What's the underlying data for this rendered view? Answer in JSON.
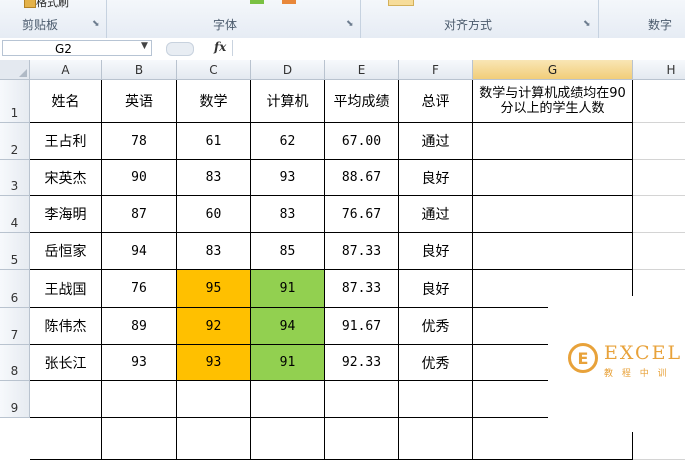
{
  "ribbon": {
    "groups": [
      "剪贴板",
      "字体",
      "对齐方式",
      "数字"
    ],
    "format_painter": "格式刷"
  },
  "formula_bar": {
    "name_box": "G2",
    "fx": "fx",
    "formula": ""
  },
  "columns": [
    "A",
    "B",
    "C",
    "D",
    "E",
    "F",
    "G",
    "H"
  ],
  "selected_column": "G",
  "rows": [
    "1",
    "2",
    "3",
    "4",
    "5",
    "6",
    "7",
    "8",
    "9"
  ],
  "table": {
    "headers": [
      "姓名",
      "英语",
      "数学",
      "计算机",
      "平均成绩",
      "总评",
      "数学与计算机成绩均在90分以上的学生人数"
    ],
    "data": [
      [
        "王占利",
        "78",
        "61",
        "62",
        "67.00",
        "通过"
      ],
      [
        "宋英杰",
        "90",
        "83",
        "93",
        "88.67",
        "良好"
      ],
      [
        "李海明",
        "87",
        "60",
        "83",
        "76.67",
        "通过"
      ],
      [
        "岳恒家",
        "94",
        "83",
        "85",
        "87.33",
        "良好"
      ],
      [
        "王战国",
        "76",
        "95",
        "91",
        "87.33",
        "良好"
      ],
      [
        "陈伟杰",
        "89",
        "92",
        "94",
        "91.67",
        "优秀"
      ],
      [
        "张长江",
        "93",
        "93",
        "91",
        "92.33",
        "优秀"
      ]
    ]
  },
  "highlight_colors": {
    "math": "#ffc000",
    "computer": "#92d050"
  },
  "watermark": {
    "logo": "E",
    "text": "EXCEL",
    "sub": "教 程 中 训"
  }
}
